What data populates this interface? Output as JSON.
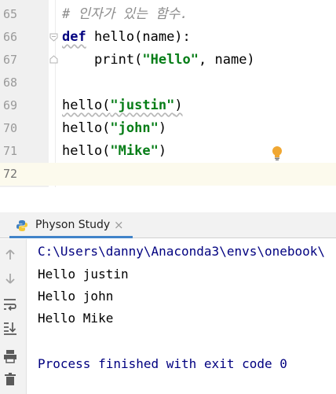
{
  "editor": {
    "lines": [
      {
        "num": "65",
        "text": "# 인자가 있는 함수."
      },
      {
        "num": "66",
        "kw": "def",
        "text": " hello(name):"
      },
      {
        "num": "67",
        "pre": "    print(",
        "str": "\"Hello\"",
        "post": ", name)"
      },
      {
        "num": "68"
      },
      {
        "num": "69",
        "pre": "hello(",
        "str": "\"justin\"",
        "post": ")"
      },
      {
        "num": "70",
        "pre": "hello(",
        "str": "\"john\"",
        "post": ")"
      },
      {
        "num": "71",
        "pre": "hello(",
        "str": "\"Mike\"",
        "post": ")"
      },
      {
        "num": "72"
      }
    ]
  },
  "run_panel": {
    "tab_label": "Physon Study",
    "tab_close": "×",
    "tab_icon": "python-icon"
  },
  "console": {
    "command": "C:\\Users\\danny\\Anaconda3\\envs\\onebook\\",
    "outputs": [
      "Hello justin",
      "Hello john",
      "Hello Mike"
    ],
    "exit_message": "Process finished with exit code 0"
  },
  "toolbar_icons": [
    "arrow-up-icon",
    "arrow-down-icon",
    "soft-wrap-icon",
    "scroll-to-end-icon",
    "print-icon",
    "trash-icon"
  ],
  "colors": {
    "keyword": "#000080",
    "string": "#067d17",
    "comment": "#8c8c8c",
    "tab_accent": "#4083c9",
    "current_line": "#fcfaed"
  }
}
